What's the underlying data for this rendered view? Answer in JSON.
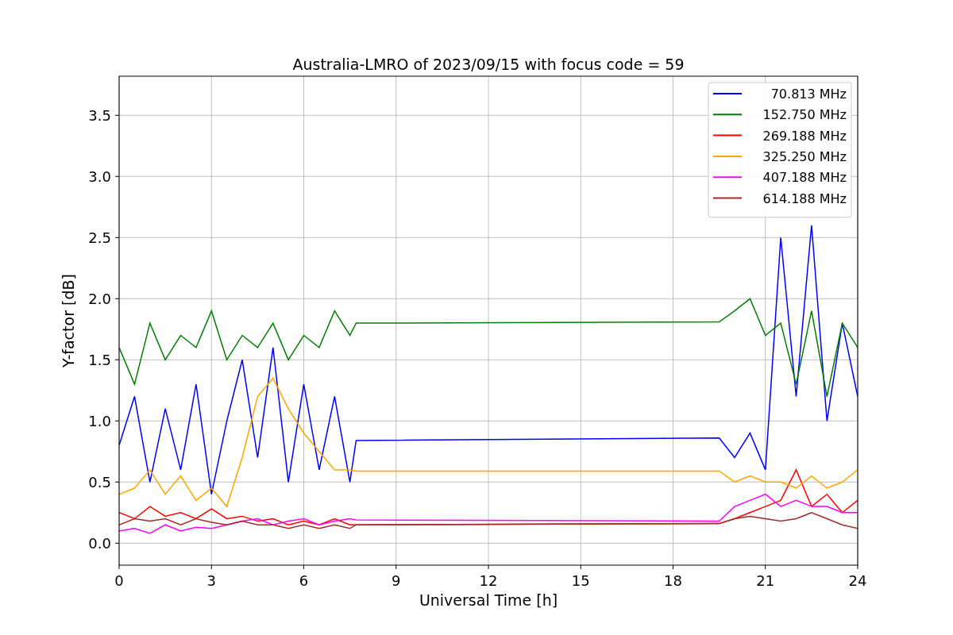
{
  "chart_data": {
    "type": "line",
    "title": "Australia-LMRO of 2023/09/15 with focus code = 59",
    "xlabel": "Universal Time [h]",
    "ylabel": "Y-factor [dB]",
    "x": [
      0,
      0.5,
      1,
      1.5,
      2,
      2.5,
      3,
      3.5,
      4,
      4.5,
      5,
      5.5,
      6,
      6.5,
      7,
      7.5,
      7.7,
      19.5,
      20,
      20.5,
      21,
      21.5,
      22,
      22.5,
      23,
      23.5,
      24
    ],
    "series": [
      {
        "name": "70.813 MHz",
        "color": "#0000ff",
        "values": [
          0.8,
          1.2,
          0.5,
          1.1,
          0.6,
          1.3,
          0.4,
          1.0,
          1.5,
          0.7,
          1.6,
          0.5,
          1.3,
          0.6,
          1.2,
          0.5,
          0.84,
          0.86,
          0.7,
          0.9,
          0.6,
          2.5,
          1.2,
          2.6,
          1.0,
          1.8,
          1.2
        ]
      },
      {
        "name": "152.750 MHz",
        "color": "#008000",
        "values": [
          1.6,
          1.3,
          1.8,
          1.5,
          1.7,
          1.6,
          1.9,
          1.5,
          1.7,
          1.6,
          1.8,
          1.5,
          1.7,
          1.6,
          1.9,
          1.7,
          1.8,
          1.81,
          1.9,
          2.0,
          1.7,
          1.8,
          1.3,
          1.9,
          1.2,
          1.8,
          1.6
        ]
      },
      {
        "name": "269.188 MHz",
        "color": "#ff0000",
        "values": [
          0.25,
          0.2,
          0.3,
          0.22,
          0.25,
          0.2,
          0.28,
          0.2,
          0.22,
          0.18,
          0.2,
          0.15,
          0.18,
          0.15,
          0.2,
          0.15,
          0.15,
          0.16,
          0.2,
          0.25,
          0.3,
          0.35,
          0.6,
          0.3,
          0.4,
          0.25,
          0.35
        ]
      },
      {
        "name": "325.250 MHz",
        "color": "#ffa500",
        "values": [
          0.4,
          0.45,
          0.6,
          0.4,
          0.55,
          0.35,
          0.45,
          0.3,
          0.7,
          1.2,
          1.35,
          1.1,
          0.9,
          0.75,
          0.6,
          0.6,
          0.59,
          0.59,
          0.5,
          0.55,
          0.5,
          0.5,
          0.45,
          0.55,
          0.45,
          0.5,
          0.6
        ]
      },
      {
        "name": "407.188 MHz",
        "color": "#ff00ff",
        "values": [
          0.1,
          0.12,
          0.08,
          0.15,
          0.1,
          0.13,
          0.12,
          0.15,
          0.18,
          0.2,
          0.15,
          0.18,
          0.2,
          0.15,
          0.18,
          0.2,
          0.19,
          0.18,
          0.3,
          0.35,
          0.4,
          0.3,
          0.35,
          0.3,
          0.3,
          0.25,
          0.25
        ]
      },
      {
        "name": "614.188 MHz",
        "color": "#a52a2a",
        "values": [
          0.15,
          0.2,
          0.18,
          0.2,
          0.15,
          0.2,
          0.17,
          0.15,
          0.18,
          0.15,
          0.15,
          0.12,
          0.15,
          0.12,
          0.15,
          0.12,
          0.15,
          0.16,
          0.2,
          0.22,
          0.2,
          0.18,
          0.2,
          0.25,
          0.2,
          0.15,
          0.12
        ]
      }
    ],
    "grid": true,
    "legend": "upper right",
    "xlim": [
      0,
      24
    ],
    "ylim": [
      -0.18,
      3.82
    ],
    "xticks": [
      0,
      3,
      6,
      9,
      12,
      15,
      18,
      21,
      24
    ],
    "yticks": [
      {
        "value": 0,
        "label": "0.0"
      },
      {
        "value": 0.5,
        "label": "0.5"
      },
      {
        "value": 1,
        "label": "1.0"
      },
      {
        "value": 1.5,
        "label": "1.5"
      },
      {
        "value": 2,
        "label": "2.0"
      },
      {
        "value": 2.5,
        "label": "2.5"
      },
      {
        "value": 3,
        "label": "3.0"
      },
      {
        "value": 3.5,
        "label": "3.5"
      }
    ]
  }
}
